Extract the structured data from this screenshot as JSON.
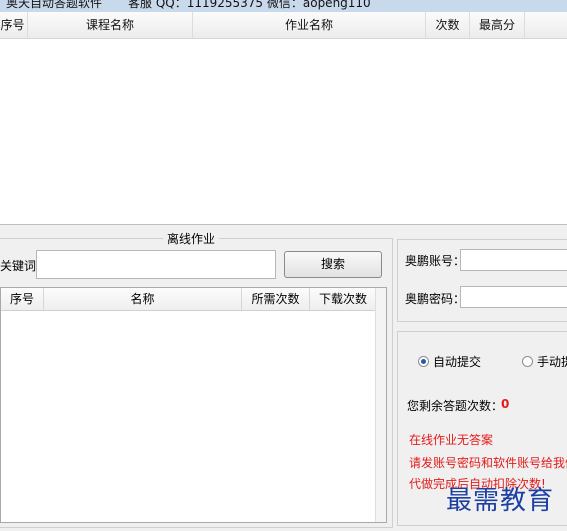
{
  "titlebar": {
    "app_name": "奥天自动答题软件",
    "contact": "客服 QQ：1119255375 微信：aopeng110"
  },
  "online_table": {
    "columns": [
      "序号",
      "课程名称",
      "作业名称",
      "次数",
      "最高分"
    ]
  },
  "offline": {
    "group_title": "离线作业",
    "keyword_label": "关键词",
    "keyword_value": "",
    "search_button": "搜索",
    "columns": [
      "序号",
      "名称",
      "所需次数",
      "下载次数"
    ]
  },
  "login": {
    "account_label": "奥鹏账号：",
    "password_label": "奥鹏密码：",
    "account_value": "",
    "password_value": ""
  },
  "mode": {
    "auto_label": "自动提交",
    "manual_label": "手动提",
    "auto_selected": true,
    "remaining_label": "您剩余答题次数：",
    "remaining_value": "0"
  },
  "notices": [
    "在线作业无答案",
    "请发账号密码和软件账号给我们答",
    "代做完成后自动扣除次数!"
  ],
  "watermark": "最需教育",
  "colors": {
    "accent_red": "#e31b1b",
    "watermark_blue": "#1b3fa3"
  }
}
